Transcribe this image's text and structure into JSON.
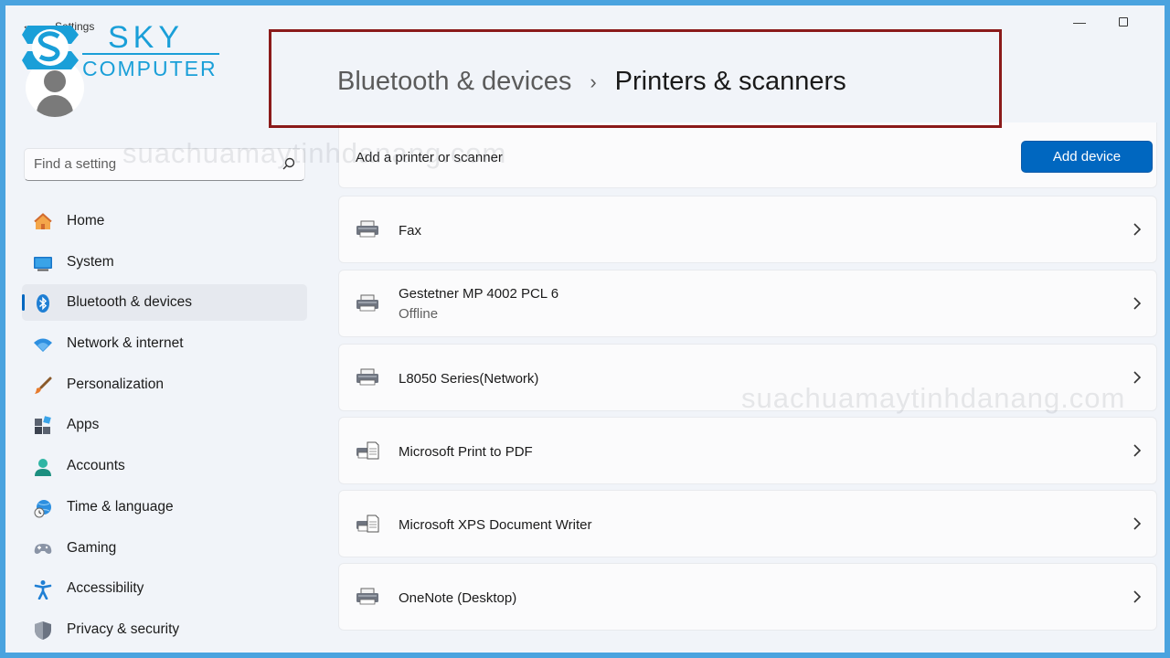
{
  "window": {
    "app_title": "Settings",
    "back_glyph": "←",
    "minimize_glyph": "—"
  },
  "logo": {
    "line1": "SKY",
    "line2": "COMPUTER"
  },
  "search": {
    "placeholder": "Find a setting",
    "value": ""
  },
  "sidebar": {
    "items": [
      {
        "label": "Home",
        "icon": "home-icon"
      },
      {
        "label": "System",
        "icon": "system-icon"
      },
      {
        "label": "Bluetooth & devices",
        "icon": "bluetooth-icon",
        "selected": true
      },
      {
        "label": "Network & internet",
        "icon": "wifi-icon"
      },
      {
        "label": "Personalization",
        "icon": "brush-icon"
      },
      {
        "label": "Apps",
        "icon": "apps-icon"
      },
      {
        "label": "Accounts",
        "icon": "accounts-icon"
      },
      {
        "label": "Time & language",
        "icon": "time-language-icon"
      },
      {
        "label": "Gaming",
        "icon": "gamepad-icon"
      },
      {
        "label": "Accessibility",
        "icon": "accessibility-icon"
      },
      {
        "label": "Privacy & security",
        "icon": "shield-icon"
      }
    ]
  },
  "breadcrumb": {
    "parent": "Bluetooth & devices",
    "separator": "›",
    "current": "Printers & scanners"
  },
  "add_section": {
    "label": "Add a printer or scanner",
    "button_label": "Add device"
  },
  "devices": [
    {
      "name": "Fax",
      "status": "",
      "icon": "printer-icon"
    },
    {
      "name": "Gestetner MP 4002 PCL 6",
      "status": "Offline",
      "icon": "printer-icon"
    },
    {
      "name": "L8050 Series(Network)",
      "status": "",
      "icon": "printer-icon"
    },
    {
      "name": "Microsoft Print to PDF",
      "status": "",
      "icon": "virtual-printer-icon"
    },
    {
      "name": "Microsoft XPS Document Writer",
      "status": "",
      "icon": "virtual-printer-icon"
    },
    {
      "name": "OneNote (Desktop)",
      "status": "",
      "icon": "printer-icon"
    }
  ],
  "watermark": {
    "text": "suachuamaytinhdanang.com"
  },
  "colors": {
    "accent": "#0067c0",
    "highlight_box": "#8b1a1a",
    "window_bg": "#f1f4f9",
    "frame": "#4aa3df"
  }
}
